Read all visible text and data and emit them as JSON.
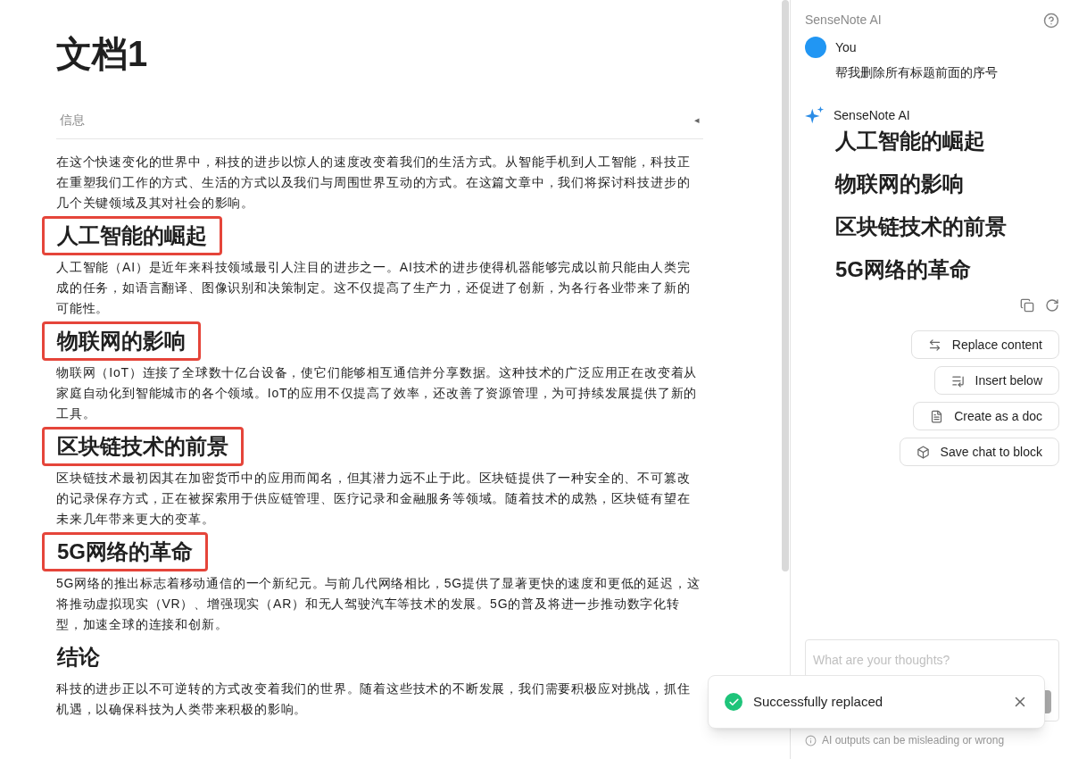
{
  "document": {
    "title": "文档1",
    "info": {
      "label": "信息",
      "toggle": "◂"
    },
    "intro": "在这个快速变化的世界中，科技的进步以惊人的速度改变着我们的生活方式。从智能手机到人工智能，科技正在重塑我们工作的方式、生活的方式以及我们与周围世界互动的方式。在这篇文章中，我们将探讨科技进步的几个关键领域及其对社会的影响。",
    "sections": [
      {
        "heading": "人工智能的崛起",
        "highlighted": true,
        "paragraph": "人工智能（AI）是近年来科技领域最引人注目的进步之一。AI技术的进步使得机器能够完成以前只能由人类完成的任务，如语言翻译、图像识别和决策制定。这不仅提高了生产力，还促进了创新，为各行各业带来了新的可能性。"
      },
      {
        "heading": "物联网的影响",
        "highlighted": true,
        "paragraph": "物联网（IoT）连接了全球数十亿台设备，使它们能够相互通信并分享数据。这种技术的广泛应用正在改变着从家庭自动化到智能城市的各个领域。IoT的应用不仅提高了效率，还改善了资源管理，为可持续发展提供了新的工具。"
      },
      {
        "heading": "区块链技术的前景",
        "highlighted": true,
        "paragraph": "区块链技术最初因其在加密货币中的应用而闻名，但其潜力远不止于此。区块链提供了一种安全的、不可篡改的记录保存方式，正在被探索用于供应链管理、医疗记录和金融服务等领域。随着技术的成熟，区块链有望在未来几年带来更大的变革。"
      },
      {
        "heading": "5G网络的革命",
        "highlighted": true,
        "paragraph": "5G网络的推出标志着移动通信的一个新纪元。与前几代网络相比，5G提供了显著更快的速度和更低的延迟，这将推动虚拟现实（VR）、增强现实（AR）和无人驾驶汽车等技术的发展。5G的普及将进一步推动数字化转型，加速全球的连接和创新。"
      },
      {
        "heading": "结论",
        "highlighted": false,
        "paragraph": "科技的进步正以不可逆转的方式改变着我们的世界。随着这些技术的不断发展，我们需要积极应对挑战，抓住机遇，以确保科技为人类带来积极的影响。"
      }
    ]
  },
  "assistant": {
    "title": "SenseNote AI",
    "messages": [
      {
        "kind": "user",
        "author": "You",
        "text": "帮我删除所有标题前面的序号"
      },
      {
        "kind": "ai",
        "author": "SenseNote AI",
        "headings": [
          "人工智能的崛起",
          "物联网的影响",
          "区块链技术的前景",
          "5G网络的革命"
        ]
      }
    ],
    "actions": [
      {
        "kind": "replace",
        "label": "Replace content"
      },
      {
        "kind": "insert",
        "label": "Insert below"
      },
      {
        "kind": "doc",
        "label": "Create as a doc"
      },
      {
        "kind": "save",
        "label": "Save chat to block"
      }
    ],
    "input": {
      "placeholder": "What are your thoughts?"
    },
    "disclaimer": "AI outputs can be misleading or wrong"
  },
  "toast": {
    "kind": "success",
    "message": "Successfully replaced"
  }
}
